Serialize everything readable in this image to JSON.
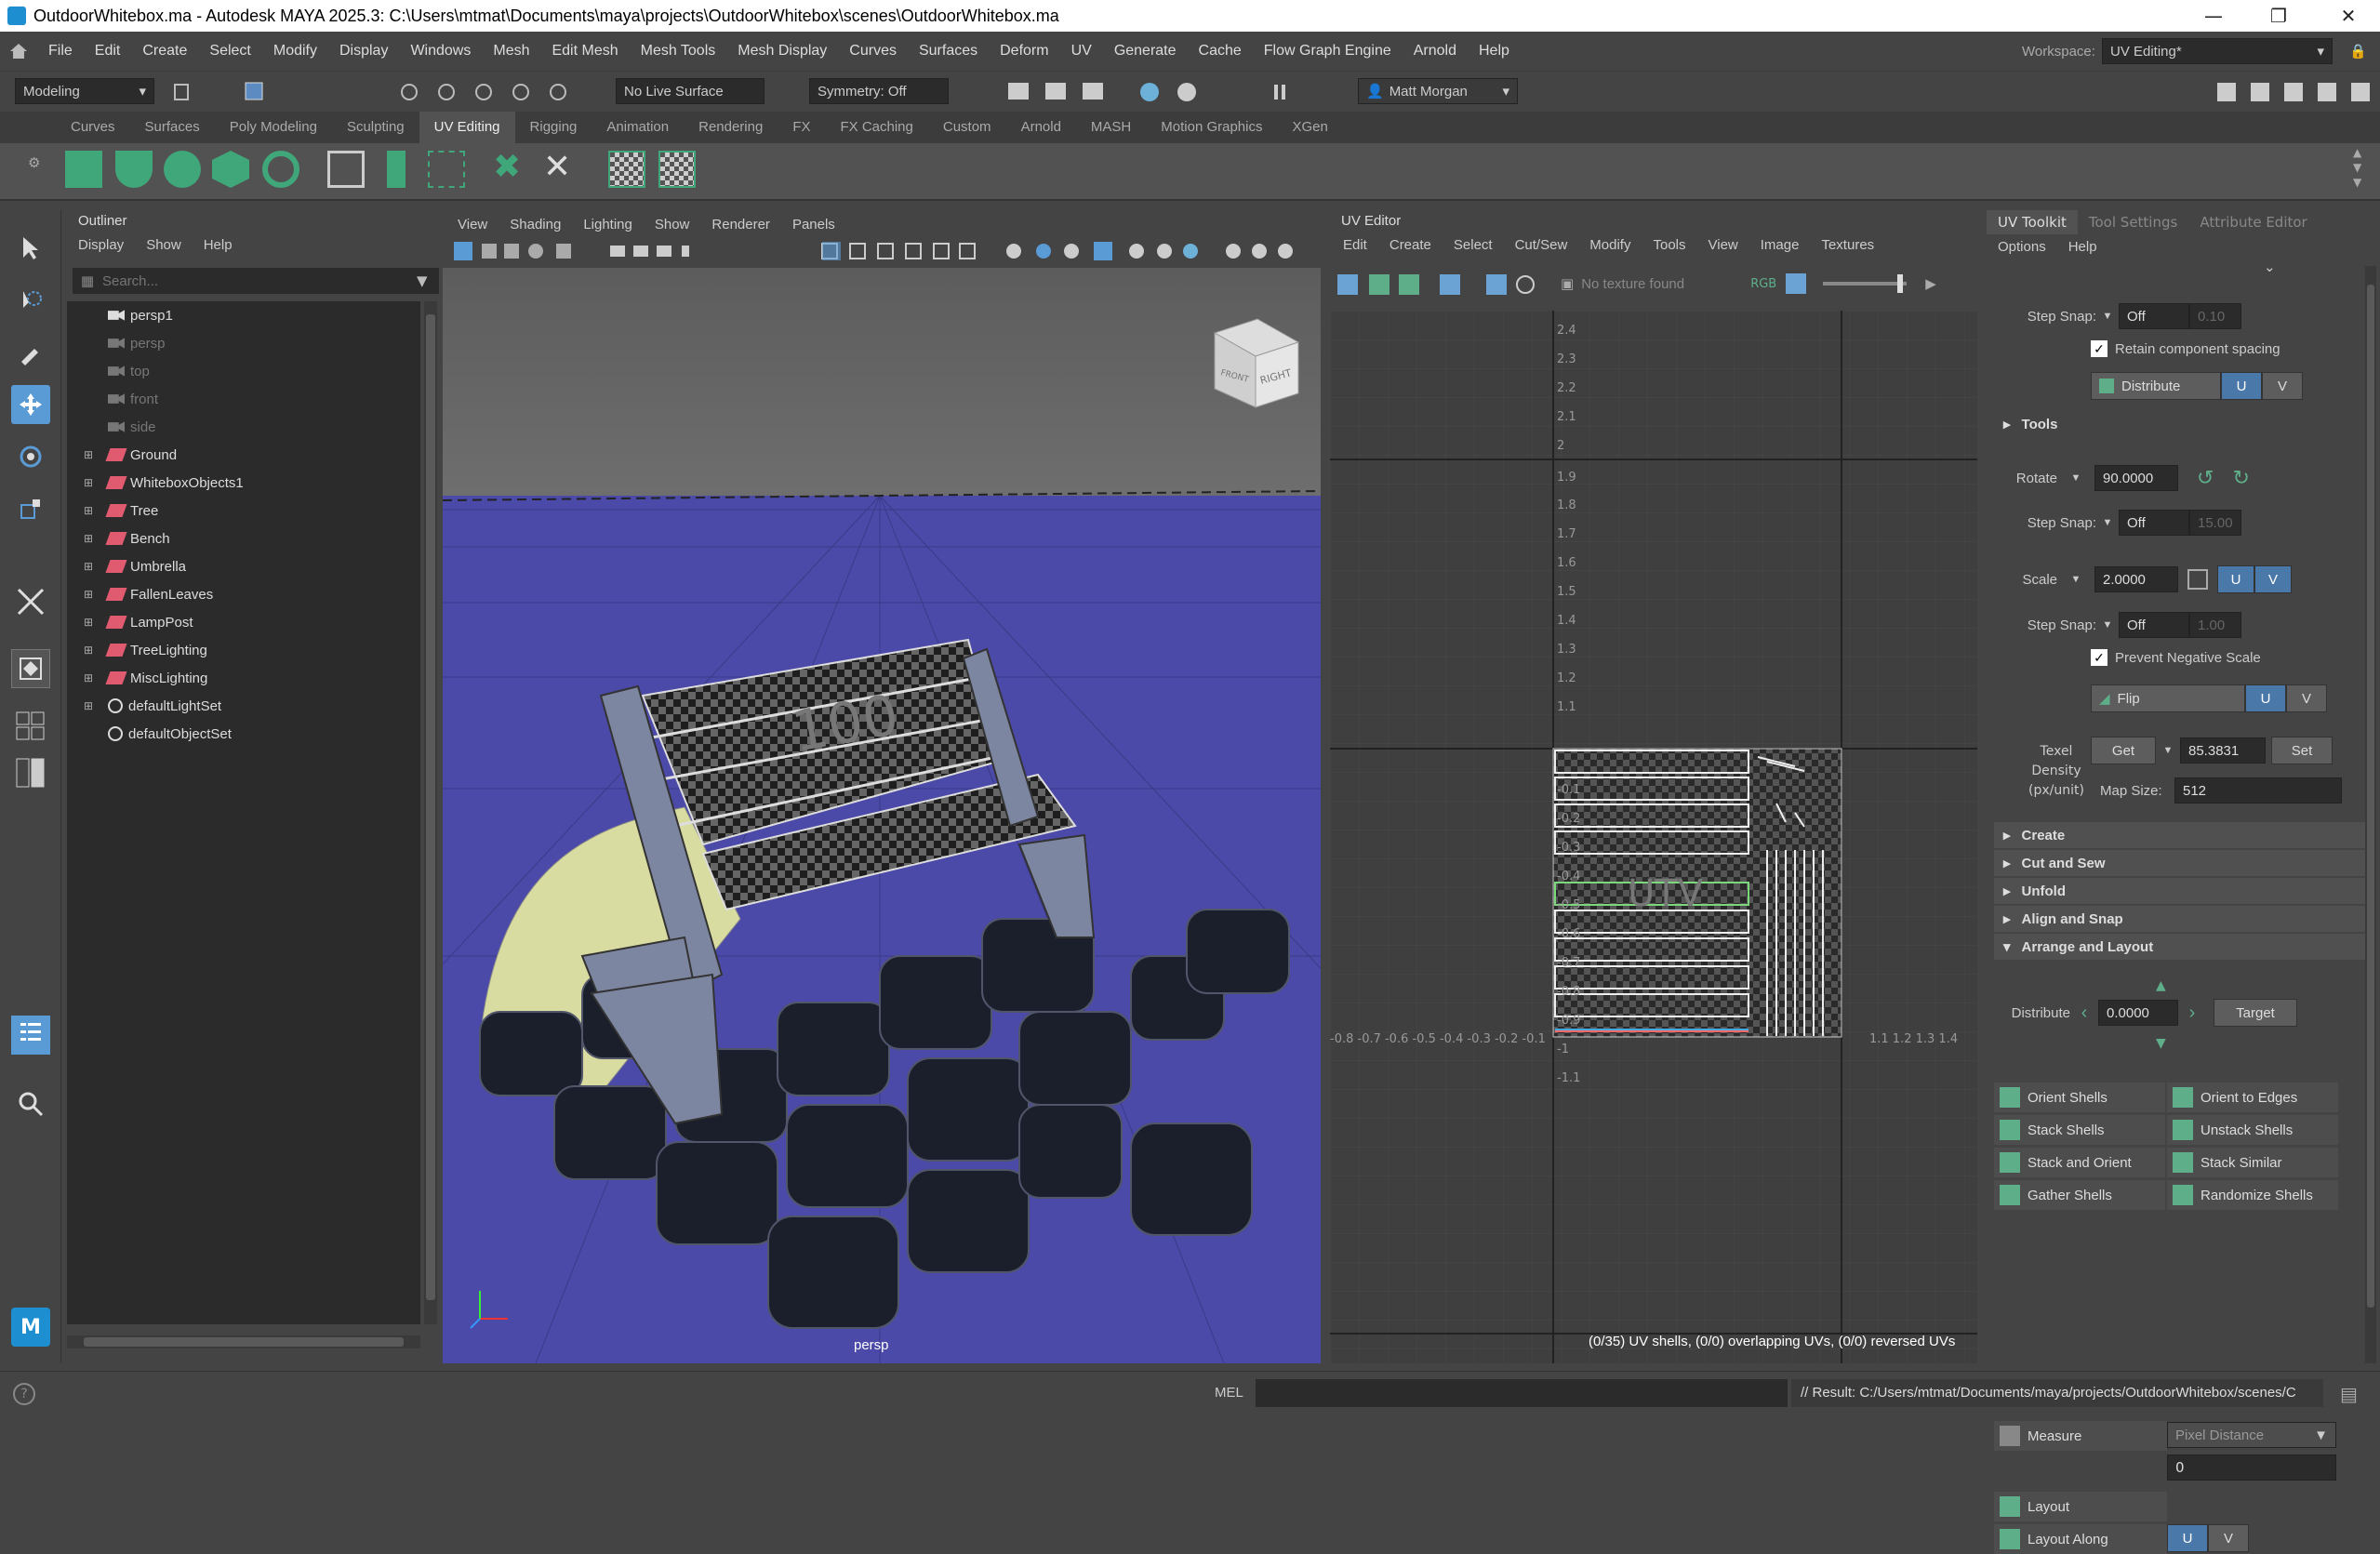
{
  "title": "OutdoorWhitebox.ma - Autodesk MAYA 2025.3: C:\\Users\\mtmat\\Documents\\maya\\projects\\OutdoorWhitebox\\scenes\\OutdoorWhitebox.ma",
  "menu": [
    "File",
    "Edit",
    "Create",
    "Select",
    "Modify",
    "Display",
    "Windows",
    "Mesh",
    "Edit Mesh",
    "Mesh Tools",
    "Mesh Display",
    "Curves",
    "Surfaces",
    "Deform",
    "UV",
    "Generate",
    "Cache",
    "Flow Graph Engine",
    "Arnold",
    "Help"
  ],
  "workspace": {
    "label": "Workspace:",
    "value": "UV Editing*"
  },
  "status": {
    "mode": "Modeling",
    "live_surface": "No Live Surface",
    "symmetry": "Symmetry: Off",
    "user": "Matt Morgan"
  },
  "shelf_tabs": [
    "Curves",
    "Surfaces",
    "Poly Modeling",
    "Sculpting",
    "UV Editing",
    "Rigging",
    "Animation",
    "Rendering",
    "FX",
    "FX Caching",
    "Custom",
    "Arnold",
    "MASH",
    "Motion Graphics",
    "XGen"
  ],
  "shelf_active": "UV Editing",
  "outliner": {
    "title": "Outliner",
    "menu": [
      "Display",
      "Show",
      "Help"
    ],
    "search_placeholder": "Search...",
    "items": [
      {
        "label": "persp1",
        "dim": false,
        "type": "camera",
        "expand": false
      },
      {
        "label": "persp",
        "dim": true,
        "type": "camera",
        "expand": false
      },
      {
        "label": "top",
        "dim": true,
        "type": "camera",
        "expand": false
      },
      {
        "label": "front",
        "dim": true,
        "type": "camera",
        "expand": false
      },
      {
        "label": "side",
        "dim": true,
        "type": "camera",
        "expand": false
      },
      {
        "label": "Ground",
        "dim": false,
        "type": "group",
        "expand": true
      },
      {
        "label": "WhiteboxObjects1",
        "dim": false,
        "type": "group",
        "expand": true
      },
      {
        "label": "Tree",
        "dim": false,
        "type": "group",
        "expand": true
      },
      {
        "label": "Bench",
        "dim": false,
        "type": "group",
        "expand": true
      },
      {
        "label": "Umbrella",
        "dim": false,
        "type": "group",
        "expand": true
      },
      {
        "label": "FallenLeaves",
        "dim": false,
        "type": "group",
        "expand": true
      },
      {
        "label": "LampPost",
        "dim": false,
        "type": "group",
        "expand": true
      },
      {
        "label": "TreeLighting",
        "dim": false,
        "type": "group",
        "expand": true
      },
      {
        "label": "MiscLighting",
        "dim": false,
        "type": "group",
        "expand": true
      },
      {
        "label": "defaultLightSet",
        "dim": false,
        "type": "set",
        "expand": true
      },
      {
        "label": "defaultObjectSet",
        "dim": false,
        "type": "set",
        "expand": false
      }
    ]
  },
  "viewport": {
    "menu": [
      "View",
      "Shading",
      "Lighting",
      "Show",
      "Renderer",
      "Panels"
    ],
    "camera_label": "persp",
    "cube_front": "FRONT",
    "cube_right": "RIGHT"
  },
  "uv_editor": {
    "title": "UV Editor",
    "menu": [
      "Edit",
      "Create",
      "Select",
      "Cut/Sew",
      "Modify",
      "Tools",
      "View",
      "Image",
      "Textures"
    ],
    "texture_status": "No texture found",
    "rgb": "RGB",
    "info": "(0/35) UV shells, (0/0) overlapping UVs, (0/0) reversed UVs",
    "v_ticks": [
      "2.4",
      "2.3",
      "2.2",
      "2.1",
      "2",
      "1.9",
      "1.8",
      "1.7",
      "1.6",
      "1.5",
      "1.4",
      "1.3",
      "1.2",
      "1.1",
      "1",
      "-0.1",
      "-0.2",
      "-0.3",
      "-0.4",
      "-0.5",
      "-0.6",
      "-0.7",
      "-0.8",
      "-0.9",
      "-1",
      "-1.1"
    ],
    "u_ticks_left": "-0.8 -0.7 -0.6 -0.5 -0.4 -0.3 -0.2 -0.1",
    "u_ticks_right": "1.1  1.2  1.3  1.4"
  },
  "toolkit": {
    "tabs": [
      "UV Toolkit",
      "Tool Settings",
      "Attribute Editor"
    ],
    "menu": [
      "Options",
      "Help"
    ],
    "step_snap_label": "Step Snap:",
    "off": "Off",
    "snap_val1": "0.10",
    "retain": "Retain component spacing",
    "distribute": "Distribute",
    "u": "U",
    "v": "V",
    "tools": "Tools",
    "rotate_label": "Rotate",
    "rotate_val": "90.0000",
    "snap_val2": "15.00",
    "scale_label": "Scale",
    "scale_val": "2.0000",
    "snap_val3": "1.00",
    "prevent": "Prevent Negative Scale",
    "flip": "Flip",
    "texel_label": "Texel Density (px/unit)",
    "get": "Get",
    "texel_val": "85.3831",
    "set": "Set",
    "map_size_label": "Map Size:",
    "map_size": "512",
    "sections": [
      "Create",
      "Cut and Sew",
      "Unfold",
      "Align and Snap",
      "Arrange and Layout"
    ],
    "distribute_val": "0.0000",
    "target": "Target",
    "buttons": [
      "Orient Shells",
      "Orient to Edges",
      "Stack Shells",
      "Unstack Shells",
      "Stack and Orient",
      "Stack Similar",
      "Gather Shells",
      "Randomize Shells"
    ],
    "measure": "Measure",
    "measure_mode": "Pixel Distance",
    "measure_val": "0",
    "layout": "Layout",
    "layout_along": "Layout Along"
  },
  "bottom": {
    "mel": "MEL",
    "result": "// Result: C:/Users/mtmat/Documents/maya/projects/OutdoorWhitebox/scenes/C"
  },
  "colors": {
    "viewport_bg": "#4b4aa8",
    "accent": "#4a78a8",
    "shelf_green": "#5fae8a"
  }
}
